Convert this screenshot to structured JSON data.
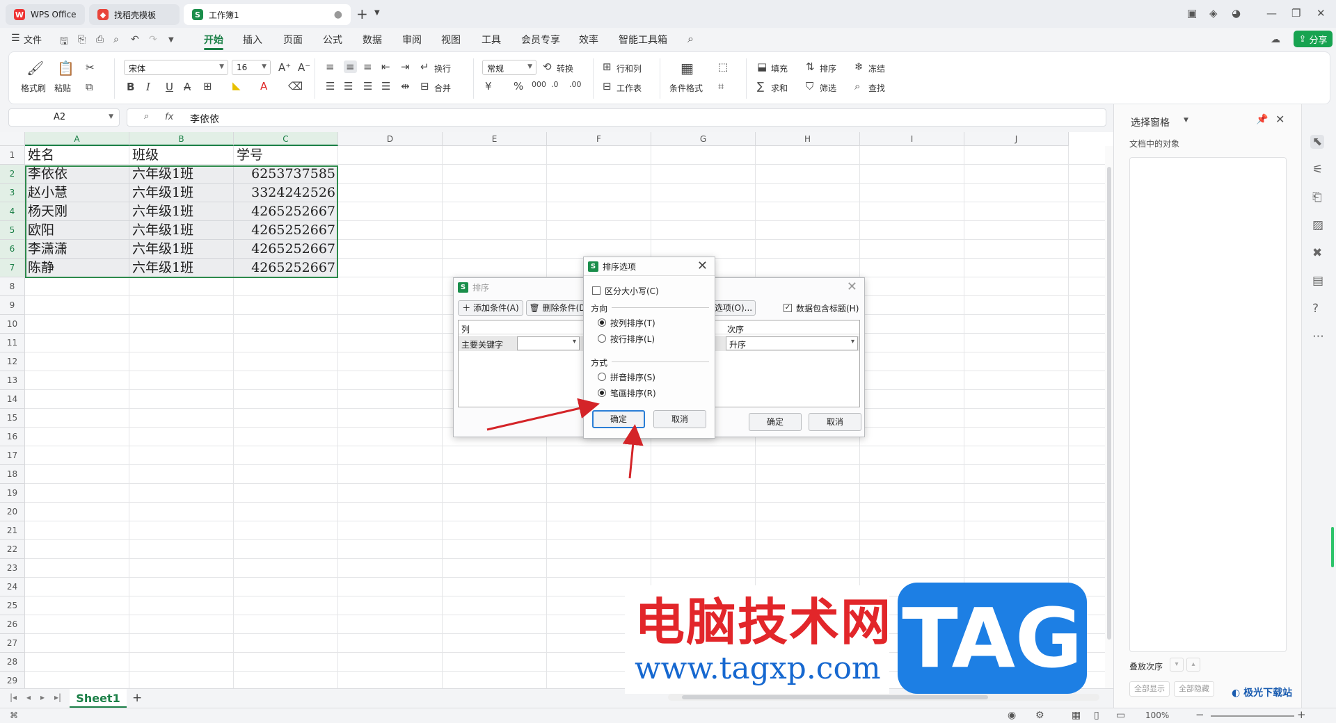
{
  "tabs": [
    {
      "label": "WPS Office",
      "icon": "wps-logo-icon"
    },
    {
      "label": "找稻壳模板",
      "icon": "docer-icon"
    },
    {
      "label": "工作簿1",
      "icon": "sheet-s-icon"
    }
  ],
  "menu": {
    "file": "文件",
    "items": [
      "开始",
      "插入",
      "页面",
      "公式",
      "数据",
      "审阅",
      "视图",
      "工具",
      "会员专享",
      "效率",
      "智能工具箱"
    ],
    "share": "分享"
  },
  "ribbon": {
    "format_painter": "格式刷",
    "paste": "粘贴",
    "font": "宋体",
    "font_size": "16",
    "wrap": "换行",
    "merge": "合并",
    "number_format": "常规",
    "convert": "转换",
    "row_col": "行和列",
    "worksheet": "工作表",
    "cond_format": "条件格式",
    "fill": "填充",
    "sort": "排序",
    "freeze": "冻结",
    "sum": "求和",
    "filter": "筛选",
    "find": "查找",
    "bold": "B",
    "italic": "I",
    "underline": "U",
    "strike": "A",
    "currency": "¥",
    "percent": "%"
  },
  "formula_bar": {
    "name_box": "A2",
    "fx": "fx",
    "value": "李依依"
  },
  "columns": [
    "A",
    "B",
    "C",
    "D",
    "E",
    "F",
    "G",
    "H",
    "I",
    "J"
  ],
  "rows": [
    "1",
    "2",
    "3",
    "4",
    "5",
    "6",
    "7",
    "8",
    "9",
    "10",
    "11",
    "12",
    "13",
    "14",
    "15",
    "16",
    "17",
    "18",
    "19",
    "20",
    "21",
    "22",
    "23",
    "24",
    "25",
    "26",
    "27",
    "28",
    "29"
  ],
  "table": {
    "headers": [
      "姓名",
      "班级",
      "学号"
    ],
    "data": [
      [
        "李依依",
        "六年级1班",
        "6253737585"
      ],
      [
        "赵小慧",
        "六年级1班",
        "3324242526"
      ],
      [
        "杨天刚",
        "六年级1班",
        "4265252667"
      ],
      [
        "欧阳",
        "六年级1班",
        "4265252667"
      ],
      [
        "李潇潇",
        "六年级1班",
        "4265252667"
      ],
      [
        "陈静",
        "六年级1班",
        "4265252667"
      ]
    ]
  },
  "sheet_tab": "Sheet1",
  "status": {
    "zoom": "100%"
  },
  "side_pane": {
    "title": "选择窗格",
    "subtitle": "文档中的对象",
    "stack_order": "叠放次序",
    "show_all": "全部显示",
    "hide_all": "全部隐藏"
  },
  "sort_dialog": {
    "title": "排序",
    "add_condition": "添加条件(A)",
    "delete_condition": "删除条件(D",
    "options_btn": "选项(O)...",
    "has_header": "数据包含标题(H)",
    "col_header": "列",
    "order_header": "次序",
    "primary_key": "主要关键字",
    "order_value": "升序",
    "ok": "确定",
    "cancel": "取消"
  },
  "options_dialog": {
    "title": "排序选项",
    "case_sensitive": "区分大小写(C)",
    "direction_group": "方向",
    "by_column": "按列排序(T)",
    "by_row": "按行排序(L)",
    "method_group": "方式",
    "pinyin": "拼音排序(S)",
    "stroke": "笔画排序(R)",
    "ok": "确定",
    "cancel": "取消"
  },
  "watermark": {
    "text": "电脑技术网",
    "url": "www.tagxp.com",
    "tag": "TAG",
    "corner_logo": "极光下载站"
  },
  "colors": {
    "accent": "#1a7f46",
    "annotation_arrow": "#d42428",
    "selection_border": "#2d8a4b"
  }
}
